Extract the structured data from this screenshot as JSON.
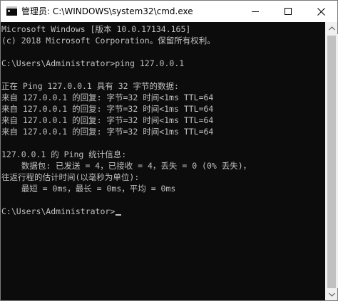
{
  "window": {
    "title": "管理员: C:\\WINDOWS\\system32\\cmd.exe",
    "icon": "cmd-icon",
    "controls": {
      "minimize_icon": "minimize-icon",
      "maximize_icon": "maximize-icon",
      "close_icon": "close-icon"
    }
  },
  "console": {
    "lines": [
      "Microsoft Windows [版本 10.0.17134.165]",
      "(c) 2018 Microsoft Corporation。保留所有权利。",
      "",
      "C:\\Users\\Administrator>ping 127.0.0.1",
      "",
      "正在 Ping 127.0.0.1 具有 32 字节的数据:",
      "来自 127.0.0.1 的回复: 字节=32 时间<1ms TTL=64",
      "来自 127.0.0.1 的回复: 字节=32 时间<1ms TTL=64",
      "来自 127.0.0.1 的回复: 字节=32 时间<1ms TTL=64",
      "来自 127.0.0.1 的回复: 字节=32 时间<1ms TTL=64",
      "",
      "127.0.0.1 的 Ping 统计信息:",
      "    数据包: 已发送 = 4，已接收 = 4，丢失 = 0 (0% 丢失)，",
      "往返行程的估计时间(以毫秒为单位):",
      "    最短 = 0ms，最长 = 0ms，平均 = 0ms",
      "",
      "C:\\Users\\Administrator>"
    ],
    "text_color": "#c0c0c0",
    "background": "#0c0c0c"
  },
  "scrollbar": {
    "up_icon": "scroll-up-arrow-icon",
    "down_icon": "scroll-down-arrow-icon"
  }
}
